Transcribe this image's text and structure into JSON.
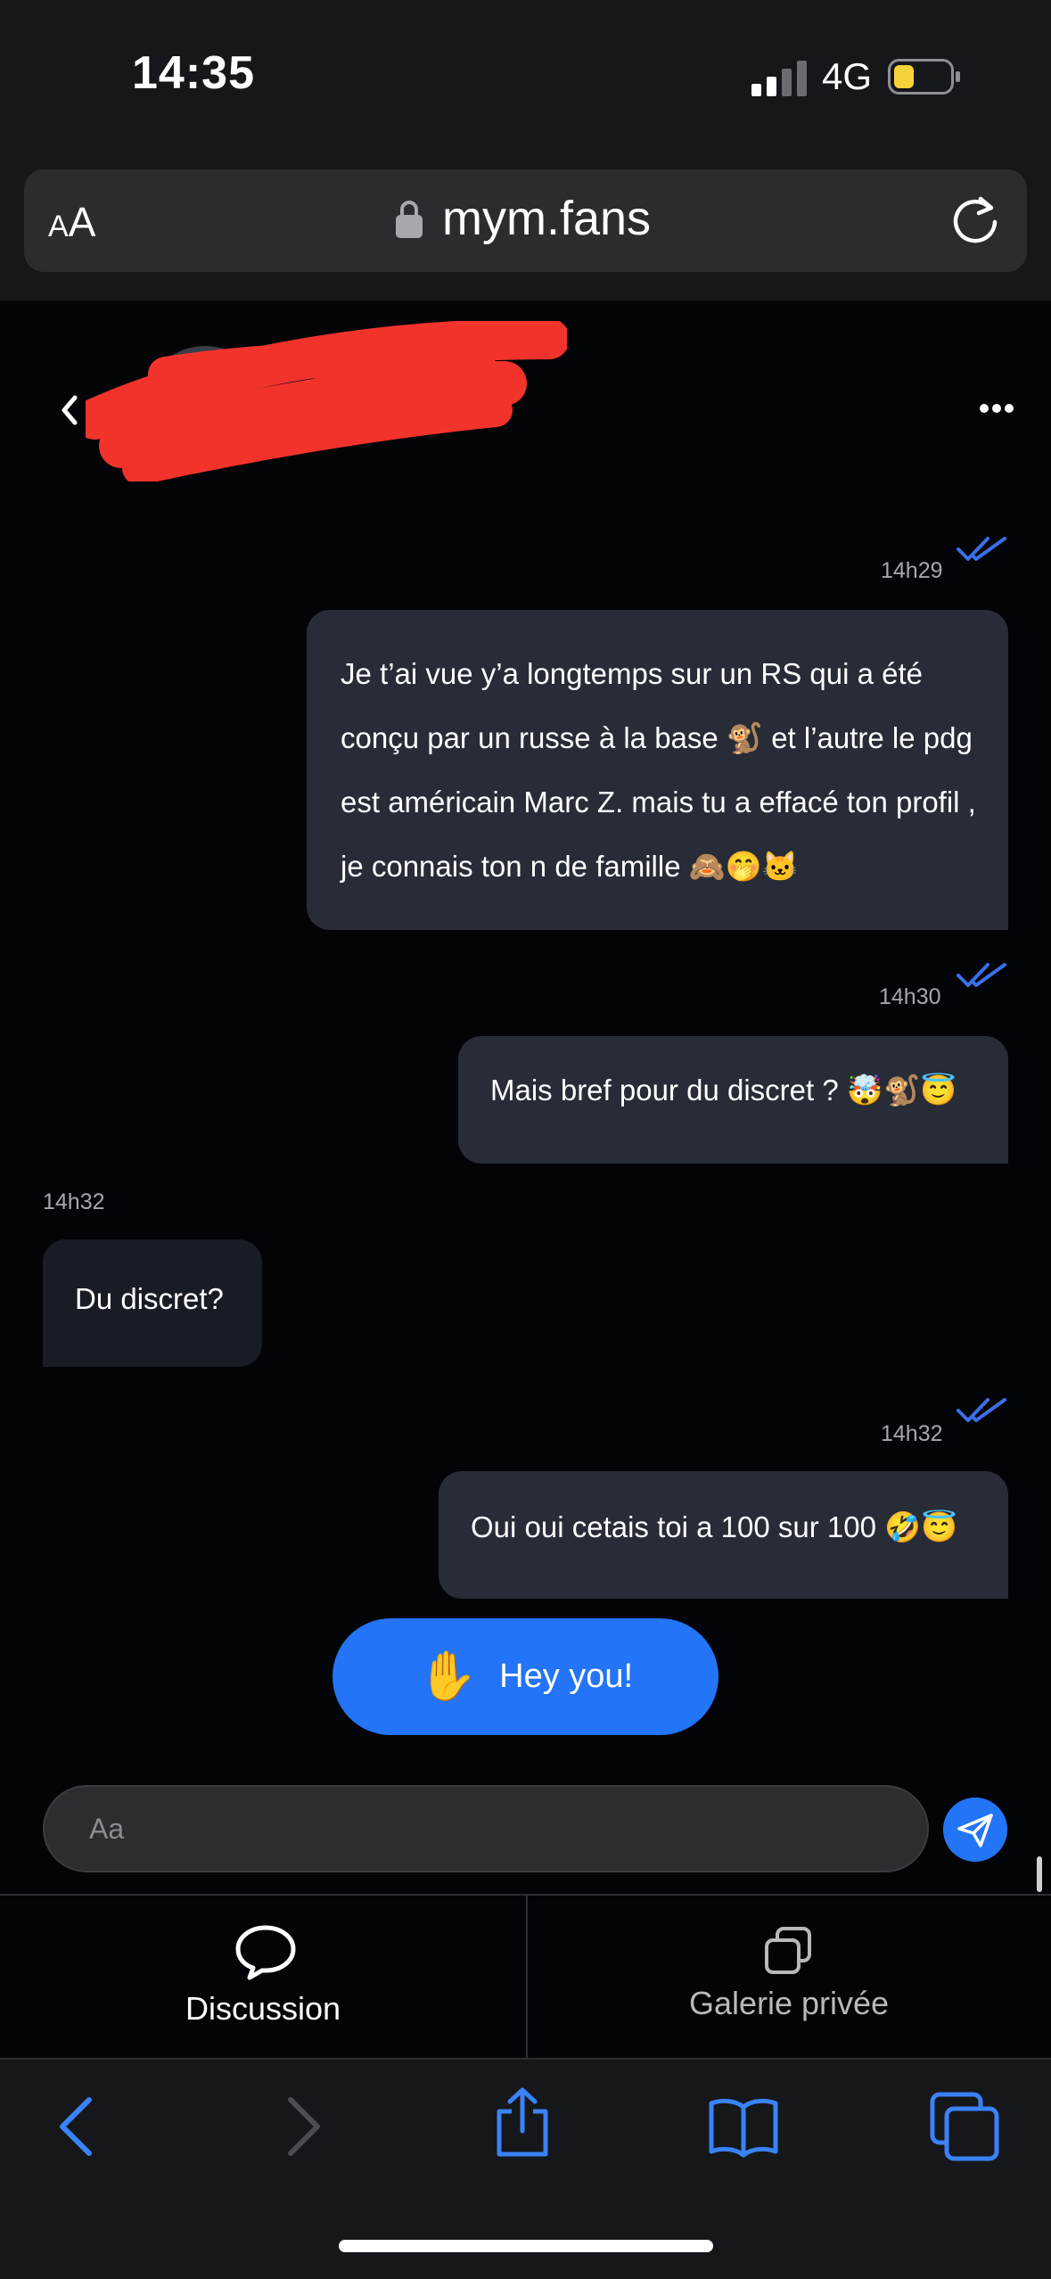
{
  "status_bar": {
    "time": "14:35",
    "network": "4G",
    "icons": [
      "signal-icon",
      "battery-icon"
    ]
  },
  "browser": {
    "text_size_label_small": "A",
    "text_size_label_large": "A",
    "url": "mym.fans",
    "icons": [
      "lock-icon",
      "reload-icon"
    ]
  },
  "chat_header": {
    "icons": [
      "chevron-left-icon",
      "more-icon"
    ]
  },
  "messages": [
    {
      "direction": "outgoing",
      "time": "14h29",
      "text": "Je t’ai vue y’a longtemps sur un RS qui a été conçu par un russe à la base 🐒 et l’autre le pdg est américain Marc Z. mais tu a effacé ton profil , je connais ton n de famille 🙈🤭🐱"
    },
    {
      "direction": "outgoing",
      "time": "14h30",
      "text": "Mais bref pour du discret ? 🤯🐒😇"
    },
    {
      "direction": "incoming",
      "time": "14h32",
      "text": "Du discret?"
    },
    {
      "direction": "outgoing",
      "time": "14h32",
      "text": "Oui oui cetais toi a 100 sur 100 🤣😇"
    }
  ],
  "quick_reply": {
    "emoji": "✋",
    "label": "Hey you!"
  },
  "composer": {
    "placeholder": "Aa",
    "value": "",
    "send_icon": "paper-plane-icon"
  },
  "tabs": [
    {
      "label": "Discussion",
      "icon": "chat-bubble-icon",
      "active": true
    },
    {
      "label": "Galerie privée",
      "icon": "copy-icon",
      "active": false
    }
  ],
  "safari_toolbar": {
    "icons": [
      "back-icon",
      "forward-icon",
      "share-icon",
      "bookmarks-icon",
      "tabs-icon"
    ]
  },
  "colors": {
    "accent": "#2374f6",
    "background": "#030408",
    "bubble_outgoing": "#272c37",
    "bubble_incoming": "#181c25",
    "read_tick": "#3b6fe6"
  }
}
